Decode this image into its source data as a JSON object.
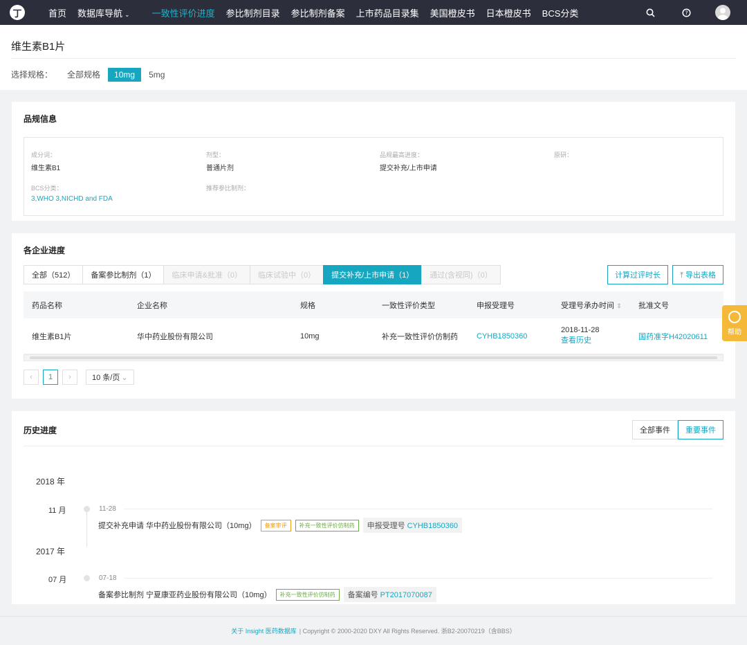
{
  "nav": {
    "logo": "丁",
    "items": [
      "首页",
      "数据库导航",
      "一致性评价进度",
      "参比制剂目录",
      "参比制剂备案",
      "上市药品目录集",
      "美国橙皮书",
      "日本橙皮书",
      "BCS分类"
    ]
  },
  "header": {
    "title": "维生素B1片",
    "spec_label": "选择规格：",
    "specs": [
      "全部规格",
      "10mg",
      "5mg"
    ]
  },
  "info": {
    "title": "品规信息",
    "fields": [
      {
        "k": "成分词：",
        "v": "维生素B1"
      },
      {
        "k": "剂型：",
        "v": "普通片剂"
      },
      {
        "k": "品规最高进度：",
        "v": "提交补充/上市申请"
      },
      {
        "k": "原研：",
        "v": ""
      },
      {
        "k": "BCS分类：",
        "v": "3,WHO 3,NICHD and FDA"
      },
      {
        "k": "推荐参比制剂：",
        "v": ""
      }
    ]
  },
  "progress": {
    "title": "各企业进度",
    "tabs": [
      "全部（512）",
      "备案参比制剂（1）",
      "临床申请&批准（0）",
      "临床试验中（0）",
      "提交补充/上市申请（1）",
      "通过(含视同)（0）"
    ],
    "btn_calc": "计算过评时长",
    "btn_export": "导出表格",
    "columns": [
      "药品名称",
      "企业名称",
      "规格",
      "一致性评价类型",
      "申报受理号",
      "受理号承办时间",
      "批准文号"
    ],
    "rows": [
      {
        "name": "维生素B1片",
        "company": "华中药业股份有限公司",
        "spec": "10mg",
        "type": "补充一致性评价仿制药",
        "accept_no": "CYHB1850360",
        "date": "2018-11-28",
        "history": "查看历史",
        "approval": "国药准字H42020611"
      }
    ],
    "page": "1",
    "page_size": "10 条/页"
  },
  "history": {
    "title": "历史进度",
    "seg": [
      "全部事件",
      "重要事件"
    ],
    "years": [
      {
        "year": "2018 年",
        "month": "11 月",
        "date": "11-28",
        "event": "提交补充申请 华中药业股份有限公司（10mg）",
        "tags": [
          "备案审评",
          "补充一致性评价仿制药"
        ],
        "ref_label": "申报受理号",
        "ref": "CYHB1850360"
      },
      {
        "year": "2017 年",
        "month": "07 月",
        "date": "07-18",
        "event": "备案参比制剂 宁夏康亚药业股份有限公司（10mg）",
        "tags": [
          "补充一致性评价仿制药"
        ],
        "ref_label": "备案编号",
        "ref": "PT2017070087"
      }
    ]
  },
  "footer": {
    "link": "关于 Insight 医药数据库",
    "text": "|  Copyright © 2000-2020 DXY All Rights Reserved. 浙B2-20070219（含BBS）"
  },
  "help": "帮助"
}
